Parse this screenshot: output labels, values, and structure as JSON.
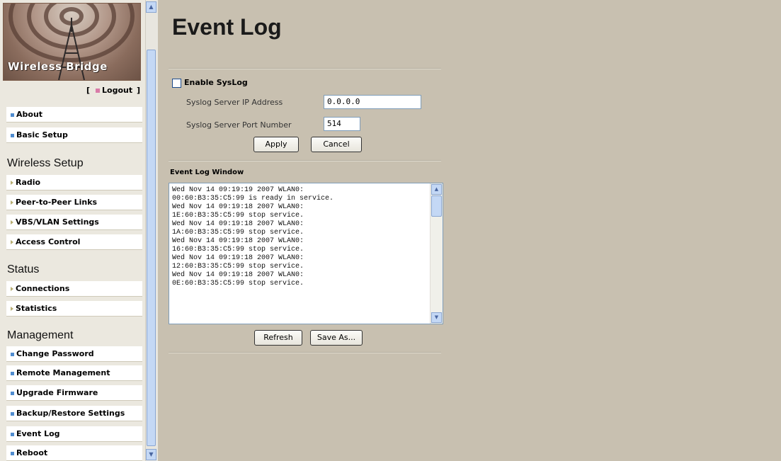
{
  "sidebar": {
    "logo_text": "Wireless Bridge",
    "logout_label": "Logout",
    "items_top": [
      {
        "label": "About"
      },
      {
        "label": "Basic Setup"
      }
    ],
    "sections": [
      {
        "title": "Wireless Setup",
        "items": [
          "Radio",
          "Peer-to-Peer Links",
          "VBS/VLAN Settings",
          "Access Control"
        ]
      },
      {
        "title": "Status",
        "items": [
          "Connections",
          "Statistics"
        ]
      },
      {
        "title": "Management",
        "items": [
          "Change Password",
          "Remote Management",
          "Upgrade Firmware",
          "Backup/Restore Settings",
          "Event Log",
          "Reboot"
        ]
      }
    ]
  },
  "main": {
    "title": "Event Log",
    "syslog": {
      "enable_label": "Enable SysLog",
      "enabled": false,
      "ip_label": "Syslog Server IP Address",
      "ip_value": "0.0.0.0",
      "port_label": "Syslog Server Port Number",
      "port_value": "514",
      "apply_label": "Apply",
      "cancel_label": "Cancel"
    },
    "log": {
      "title": "Event Log Window",
      "lines": [
        "Wed Nov 14 09:19:19 2007 WLAN0:",
        "00:60:B3:35:C5:99 is ready in service.",
        "Wed Nov 14 09:19:18 2007 WLAN0:",
        "1E:60:B3:35:C5:99 stop service.",
        "Wed Nov 14 09:19:18 2007 WLAN0:",
        "1A:60:B3:35:C5:99 stop service.",
        "Wed Nov 14 09:19:18 2007 WLAN0:",
        "16:60:B3:35:C5:99 stop service.",
        "Wed Nov 14 09:19:18 2007 WLAN0:",
        "12:60:B3:35:C5:99 stop service.",
        "Wed Nov 14 09:19:18 2007 WLAN0:",
        "0E:60:B3:35:C5:99 stop service."
      ],
      "refresh_label": "Refresh",
      "save_label": "Save As..."
    }
  }
}
